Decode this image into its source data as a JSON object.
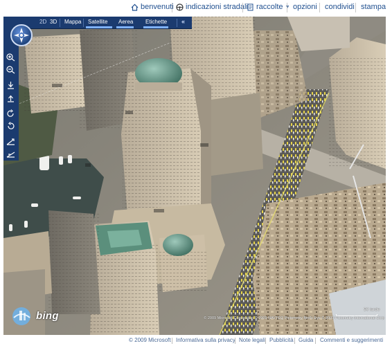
{
  "nav": {
    "benvenuti": "benvenuti",
    "indicazioni": "indicazioni stradali",
    "raccolte": "raccolte",
    "opzioni": "opzioni",
    "condividi": "condividi",
    "stampa": "stampa"
  },
  "mapbar": {
    "mode_2d": "2D",
    "mode_3d": "3D",
    "mappa": "Mappa",
    "satellite": "Satellite",
    "aerea": "Aerea",
    "etichette": "Etichette",
    "collapse": "«"
  },
  "map": {
    "brand": "bing",
    "scale_label": "50 iarde",
    "copyright": "© 2009 Microsoft Corporation   © 2009 NAVTEQ   Pictometry Bird's Eye © 2009 Pictometry International Corp",
    "colors": {
      "bar": "#1b3b6f",
      "water": "#3f4d4a",
      "building_light": "#d8c6a8",
      "copper_dome": "#5b8f7c"
    }
  },
  "footer": {
    "copyright": "© 2009 Microsoft",
    "privacy": "Informativa sulla privacy",
    "legal": "Note legali",
    "ads": "Pubblicità",
    "help": "Guida",
    "feedback": "Commenti e suggerimenti"
  }
}
